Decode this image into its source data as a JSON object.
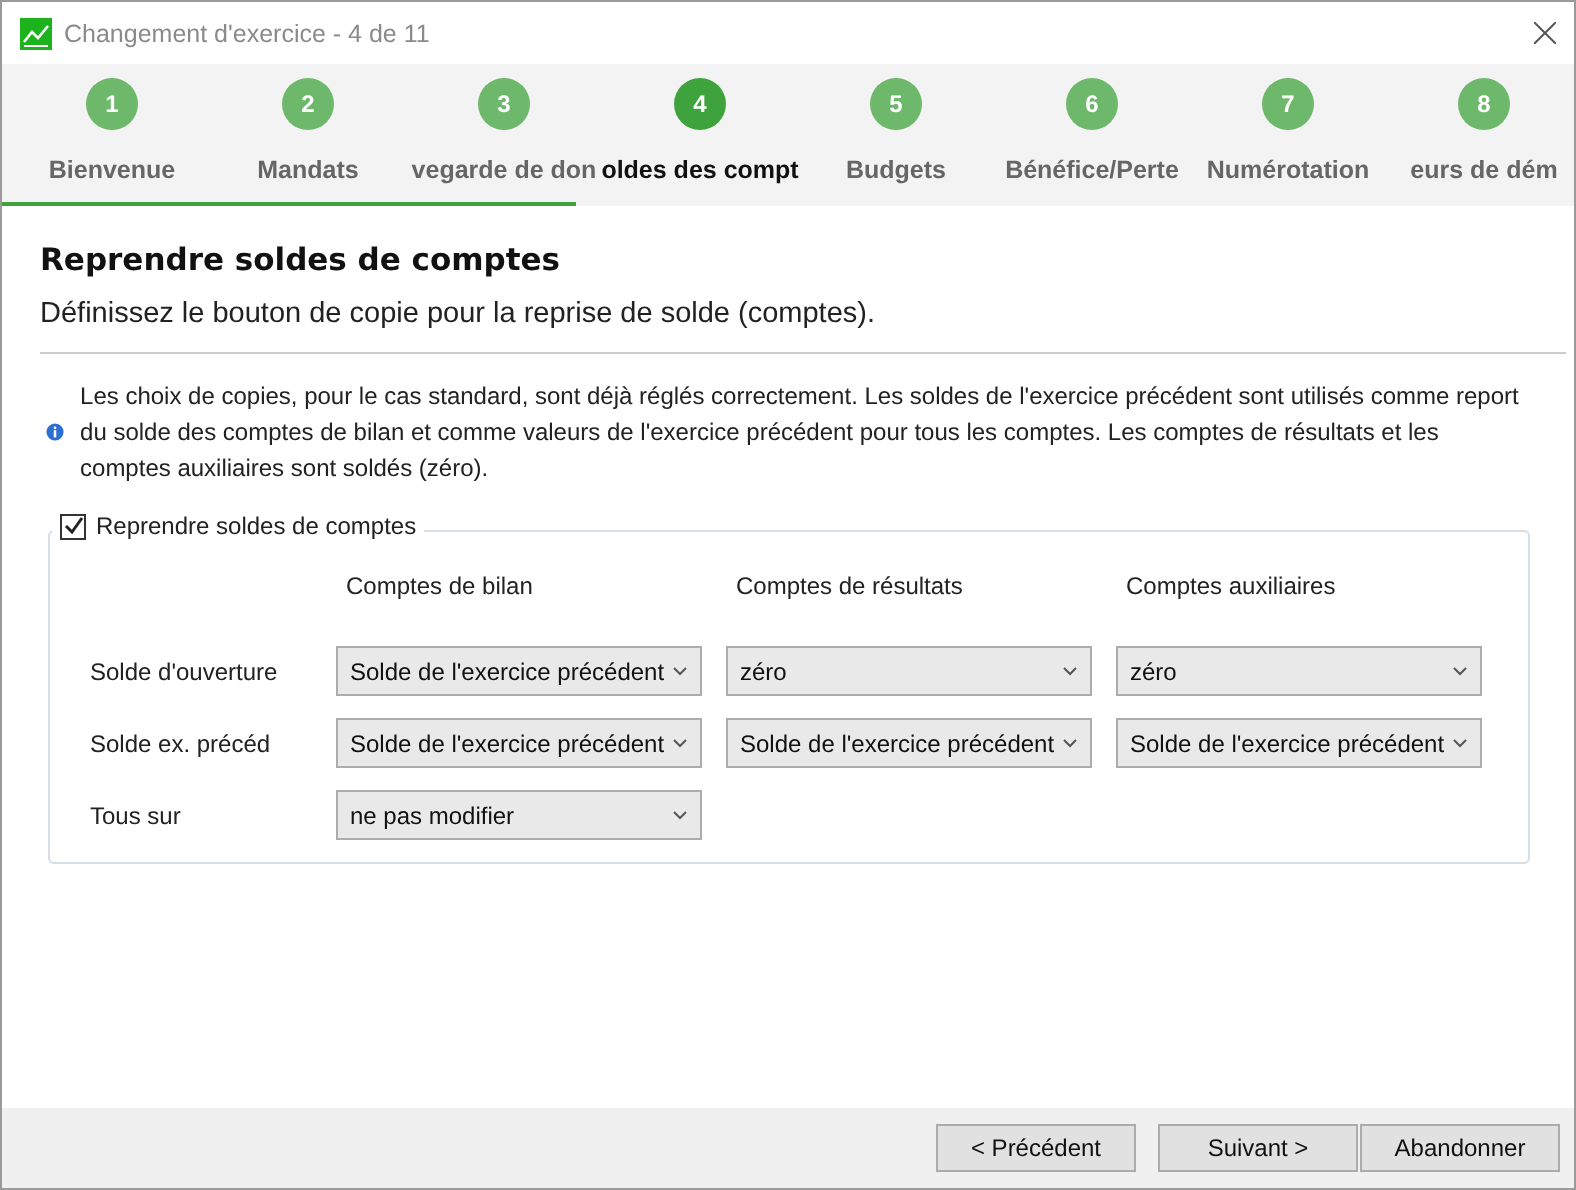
{
  "window": {
    "title": "Changement d'exercice - 4 de 11"
  },
  "steps": [
    {
      "number": "1",
      "label": "Bienvenue",
      "selected": false
    },
    {
      "number": "2",
      "label": "Mandats",
      "selected": false
    },
    {
      "number": "3",
      "label": "vegarde de don",
      "selected": false
    },
    {
      "number": "4",
      "label": "oldes des compt",
      "selected": true
    },
    {
      "number": "5",
      "label": "Budgets",
      "selected": false
    },
    {
      "number": "6",
      "label": "Bénéfice/Perte",
      "selected": false
    },
    {
      "number": "7",
      "label": "Numérotation",
      "selected": false
    },
    {
      "number": "8",
      "label": "eurs de dém",
      "selected": false
    }
  ],
  "progress": {
    "level": 0.365
  },
  "heading": "Reprendre soldes de comptes",
  "subtitle": "Définissez le bouton de copie pour la reprise de solde (comptes).",
  "info": "Les choix de copies, pour le cas standard, sont déjà réglés correctement. Les soldes de l'exercice précédent sont utilisés comme report du solde des comptes de bilan et comme valeurs de l'exercice précédent pour tous les comptes. Les comptes de résultats et les comptes auxiliaires sont soldés (zéro).",
  "group": {
    "label": "Reprendre soldes de comptes",
    "checked": true,
    "columns": [
      "Comptes de bilan",
      "Comptes de résultats",
      "Comptes auxiliaires"
    ],
    "rows": [
      {
        "label": "Solde d'ouverture",
        "values": [
          "Solde de l'exercice précédent",
          "zéro",
          "zéro"
        ]
      },
      {
        "label": "Solde ex. précéd",
        "values": [
          "Solde de l'exercice précédent",
          "Solde de l'exercice précédent",
          "Solde de l'exercice précédent"
        ]
      },
      {
        "label": "Tous sur",
        "values": [
          "ne pas modifier"
        ]
      }
    ]
  },
  "buttons": [
    "< Précédent",
    "Suivant >",
    "Abandonner"
  ]
}
